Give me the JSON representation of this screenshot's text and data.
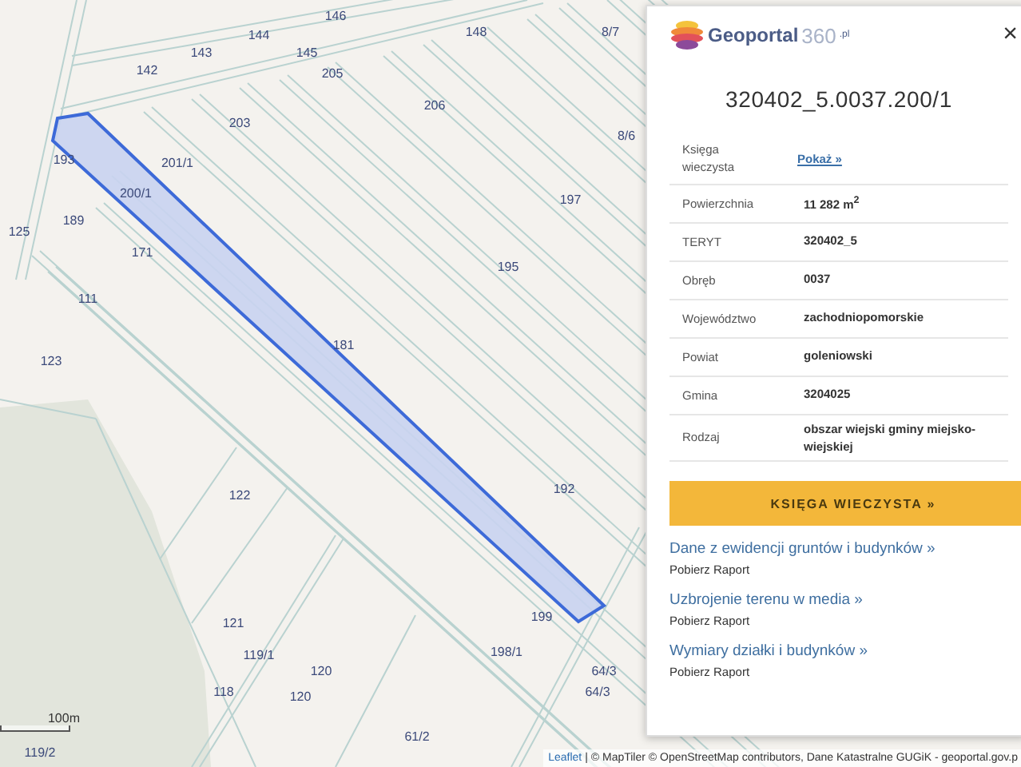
{
  "map": {
    "parcels": [
      {
        "label": "146"
      },
      {
        "label": "144"
      },
      {
        "label": "148"
      },
      {
        "label": "8/7"
      },
      {
        "label": "143"
      },
      {
        "label": "145"
      },
      {
        "label": "142"
      },
      {
        "label": "205"
      },
      {
        "label": "206"
      },
      {
        "label": "203"
      },
      {
        "label": "8/6"
      },
      {
        "label": "193"
      },
      {
        "label": "201/1"
      },
      {
        "label": "200/1"
      },
      {
        "label": "197"
      },
      {
        "label": "125"
      },
      {
        "label": "189"
      },
      {
        "label": "171"
      },
      {
        "label": "195"
      },
      {
        "label": "111"
      },
      {
        "label": "181"
      },
      {
        "label": "123"
      },
      {
        "label": "122"
      },
      {
        "label": "192"
      },
      {
        "label": "121"
      },
      {
        "label": "199"
      },
      {
        "label": "119/1"
      },
      {
        "label": "198/1"
      },
      {
        "label": "120"
      },
      {
        "label": "64/3"
      },
      {
        "label": "118"
      },
      {
        "label": "120"
      },
      {
        "label": "64/3"
      },
      {
        "label": "61/2"
      },
      {
        "label": "119/2"
      }
    ],
    "scale": "100m",
    "attribution": {
      "link": "Leaflet",
      "text": "| © MapTiler © OpenStreetMap contributors, Dane Katastralne GUGiK - geoportal.gov.p"
    }
  },
  "panel": {
    "logo": {
      "name": "Geoportal",
      "suffix": "360",
      "tld": ".pl"
    },
    "close": "×",
    "title": "320402_5.0037.200/1",
    "rows": [
      {
        "label": "Księga wieczysta",
        "value": "Pokaż »",
        "kind": "link"
      },
      {
        "label": "Powierzchnia",
        "value": "11 282 m$^{2}$",
        "kind": "text"
      },
      {
        "label": "TERYT",
        "value": "320402_5",
        "kind": "text"
      },
      {
        "label": "Obręb",
        "value": "0037",
        "kind": "text"
      },
      {
        "label": "Województwo",
        "value": "zachodniopomorskie",
        "kind": "text"
      },
      {
        "label": "Powiat",
        "value": "goleniowski",
        "kind": "text"
      },
      {
        "label": "Gmina",
        "value": "3204025",
        "kind": "text"
      },
      {
        "label": "Rodzaj",
        "value": "obszar wiejski gminy miejsko-wiejskiej",
        "kind": "text"
      }
    ],
    "button": "KSIĘGA WIECZYSTA »",
    "links": [
      {
        "title": "Dane z ewidencji gruntów i budynków »",
        "sub": "Pobierz Raport"
      },
      {
        "title": "Uzbrojenie terenu w media »",
        "sub": "Pobierz Raport"
      },
      {
        "title": "Wymiary działki i budynków »",
        "sub": "Pobierz Raport"
      }
    ]
  }
}
